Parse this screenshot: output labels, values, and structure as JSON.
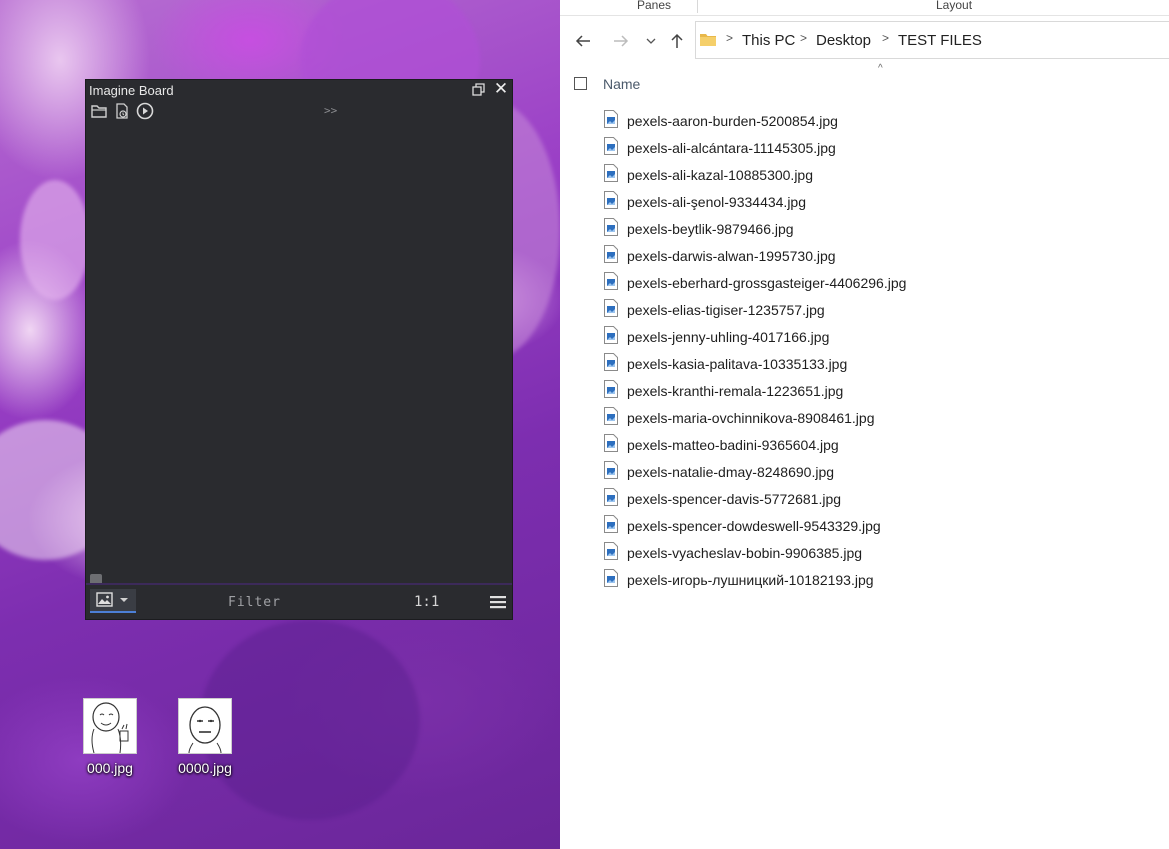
{
  "imagine_board": {
    "title": "Imagine Board",
    "expand_label": ">>",
    "filter_label": "Filter",
    "zoom_label": "1:1"
  },
  "desktop_icons": [
    {
      "label": "000.jpg"
    },
    {
      "label": "0000.jpg"
    }
  ],
  "explorer": {
    "ribbon": {
      "panes": "Panes",
      "layout": "Layout"
    },
    "breadcrumb": [
      "This PC",
      "Desktop",
      "TEST FILES"
    ],
    "column_name": "Name",
    "files": [
      "pexels-aaron-burden-5200854.jpg",
      "pexels-ali-alcántara-11145305.jpg",
      "pexels-ali-kazal-10885300.jpg",
      "pexels-ali-şenol-9334434.jpg",
      "pexels-beytlik-9879466.jpg",
      "pexels-darwis-alwan-1995730.jpg",
      "pexels-eberhard-grossgasteiger-4406296.jpg",
      "pexels-elias-tigiser-1235757.jpg",
      "pexels-jenny-uhling-4017166.jpg",
      "pexels-kasia-palitava-10335133.jpg",
      "pexels-kranthi-remala-1223651.jpg",
      "pexels-maria-ovchinnikova-8908461.jpg",
      "pexels-matteo-badini-9365604.jpg",
      "pexels-natalie-dmay-8248690.jpg",
      "pexels-spencer-davis-5772681.jpg",
      "pexels-spencer-dowdeswell-9543329.jpg",
      "pexels-vyacheslav-bobin-9906385.jpg",
      "pexels-игорь-лушницкий-10182193.jpg"
    ]
  },
  "colors": {
    "imagine_board_bg": "#2a2b2f",
    "accent_underline": "#4c7fd6",
    "explorer_bg": "#ffffff"
  }
}
